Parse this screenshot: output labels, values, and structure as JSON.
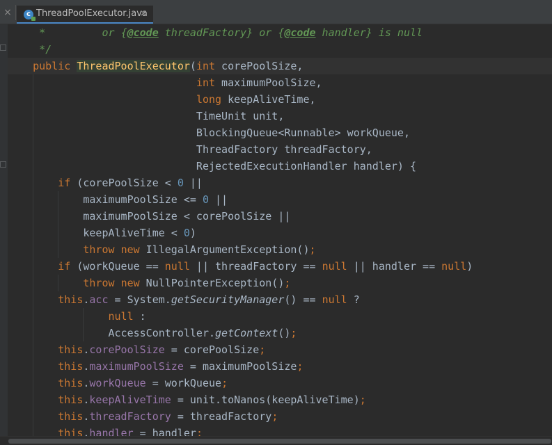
{
  "tabbar": {
    "close_glyph": "×",
    "active_tab": {
      "icon": "java-class-icon",
      "icon_letter": "c",
      "label": "ThreadPoolExecutor.java",
      "close_glyph": "×"
    }
  },
  "colors": {
    "background": "#2b2b2b",
    "keyword": "#cc7832",
    "number": "#6897bb",
    "field": "#9876aa",
    "doc_comment": "#629755",
    "method_declaration": "#ffc66d",
    "default_text": "#a9b7c6",
    "tab_underline": "#4a88c7"
  },
  "code": {
    "l1": {
      "star": "     *         or ",
      "b1": "{",
      "tag1": "@code",
      "t1": " threadFactory",
      "b2": "}",
      "mid": " or ",
      "b3": "{",
      "tag2": "@code",
      "t2": " handler",
      "b4": "}",
      "end": " is null"
    },
    "l2": {
      "text": "     */"
    },
    "l3": {
      "indent": "    ",
      "kw": "public",
      "sp": " ",
      "name": "ThreadPoolExecutor",
      "paren": "(",
      "type": "int",
      "rest": " corePoolSize,"
    },
    "l4": {
      "indent": "                              ",
      "type": "int",
      "rest": " maximumPoolSize,"
    },
    "l5": {
      "indent": "                              ",
      "type": "long",
      "rest": " keepAliveTime,"
    },
    "l6": {
      "text": "                              TimeUnit unit,"
    },
    "l7": {
      "text": "                              BlockingQueue<Runnable> workQueue,"
    },
    "l8": {
      "text": "                              ThreadFactory threadFactory,"
    },
    "l9": {
      "text": "                              RejectedExecutionHandler handler) {"
    },
    "l10": {
      "indent": "        ",
      "kw": "if",
      "mid": " (corePoolSize < ",
      "num": "0",
      "end": " ||"
    },
    "l11": {
      "mid": "            maximumPoolSize <= ",
      "num": "0",
      "end": " ||"
    },
    "l12": {
      "text": "            maximumPoolSize < corePoolSize ||"
    },
    "l13": {
      "mid": "            keepAliveTime < ",
      "num": "0",
      "end": ")"
    },
    "l14": {
      "indent": "            ",
      "kw1": "throw",
      "sp": " ",
      "kw2": "new",
      "end": " IllegalArgumentException()",
      "semi": ";"
    },
    "l15": {
      "indent": "        ",
      "kw1": "if",
      "a": " (workQueue == ",
      "n1": "null",
      "b": " || threadFactory == ",
      "n2": "null",
      "c": " || handler == ",
      "n3": "null",
      "d": ")"
    },
    "l16": {
      "indent": "            ",
      "kw1": "throw",
      "sp": " ",
      "kw2": "new",
      "end": " NullPointerException()",
      "semi": ";"
    },
    "l17": {
      "indent": "        ",
      "this": "this",
      "dot": ".",
      "field": "acc",
      "a": " = System.",
      "method": "getSecurityManager",
      "b": "() == ",
      "n": "null",
      "c": " ?"
    },
    "l18": {
      "indent": "                ",
      "n": "null",
      "end": " :"
    },
    "l19": {
      "indent": "                ",
      "a": "AccessController.",
      "method": "getContext",
      "b": "()",
      "semi": ";"
    },
    "l20": {
      "indent": "        ",
      "this": "this",
      "dot": ".",
      "field": "corePoolSize",
      "rest": " = corePoolSize",
      "semi": ";"
    },
    "l21": {
      "indent": "        ",
      "this": "this",
      "dot": ".",
      "field": "maximumPoolSize",
      "rest": " = maximumPoolSize",
      "semi": ";"
    },
    "l22": {
      "indent": "        ",
      "this": "this",
      "dot": ".",
      "field": "workQueue",
      "rest": " = workQueue",
      "semi": ";"
    },
    "l23": {
      "indent": "        ",
      "this": "this",
      "dot": ".",
      "field": "keepAliveTime",
      "rest": " = unit.toNanos(keepAliveTime)",
      "semi": ";"
    },
    "l24": {
      "indent": "        ",
      "this": "this",
      "dot": ".",
      "field": "threadFactory",
      "rest": " = threadFactory",
      "semi": ";"
    },
    "l25": {
      "indent": "        ",
      "this": "this",
      "dot": ".",
      "field": "handler",
      "rest": " = handler",
      "semi": ";"
    }
  }
}
